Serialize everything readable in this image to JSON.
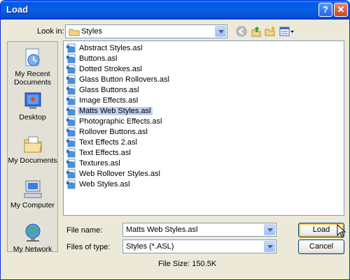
{
  "window": {
    "title": "Load",
    "help_label": "?",
    "close_label": "✕"
  },
  "toolbar": {
    "look_in_label": "Look in:",
    "look_in_value": "Styles"
  },
  "places": [
    {
      "name": "place-my-recent-documents",
      "icon": "recent-documents-icon",
      "label1": "My Recent",
      "label2": "Documents"
    },
    {
      "name": "place-desktop",
      "icon": "desktop-icon",
      "label1": "Desktop",
      "label2": ""
    },
    {
      "name": "place-my-documents",
      "icon": "my-documents-icon",
      "label1": "My Documents",
      "label2": ""
    },
    {
      "name": "place-my-computer",
      "icon": "my-computer-icon",
      "label1": "My Computer",
      "label2": ""
    },
    {
      "name": "place-my-network",
      "icon": "my-network-icon",
      "label1": "My Network",
      "label2": ""
    }
  ],
  "files": [
    "Abstract Styles.asl",
    "Buttons.asl",
    "Dotted Strokes.asl",
    "Glass Button Rollovers.asl",
    "Glass Buttons.asl",
    "Image Effects.asl",
    "Matts Web Styles.asl",
    "Photographic Effects.asl",
    "Rollover Buttons.asl",
    "Text Effects 2.asl",
    "Text Effects.asl",
    "Textures.asl",
    "Web Rollover Styles.asl",
    "Web Styles.asl"
  ],
  "selected_file": "Matts Web Styles.asl",
  "form": {
    "file_name_label": "File name:",
    "file_name_value": "Matts Web Styles.asl",
    "file_type_label": "Files of type:",
    "file_type_value": "Styles (*.ASL)",
    "load_label": "Load",
    "cancel_label": "Cancel"
  },
  "status": {
    "file_size": "File Size: 150.5K"
  },
  "colors": {
    "titlebar": "#0058ee",
    "dialog": "#ece9d8",
    "selection": "#c1d2ee"
  }
}
